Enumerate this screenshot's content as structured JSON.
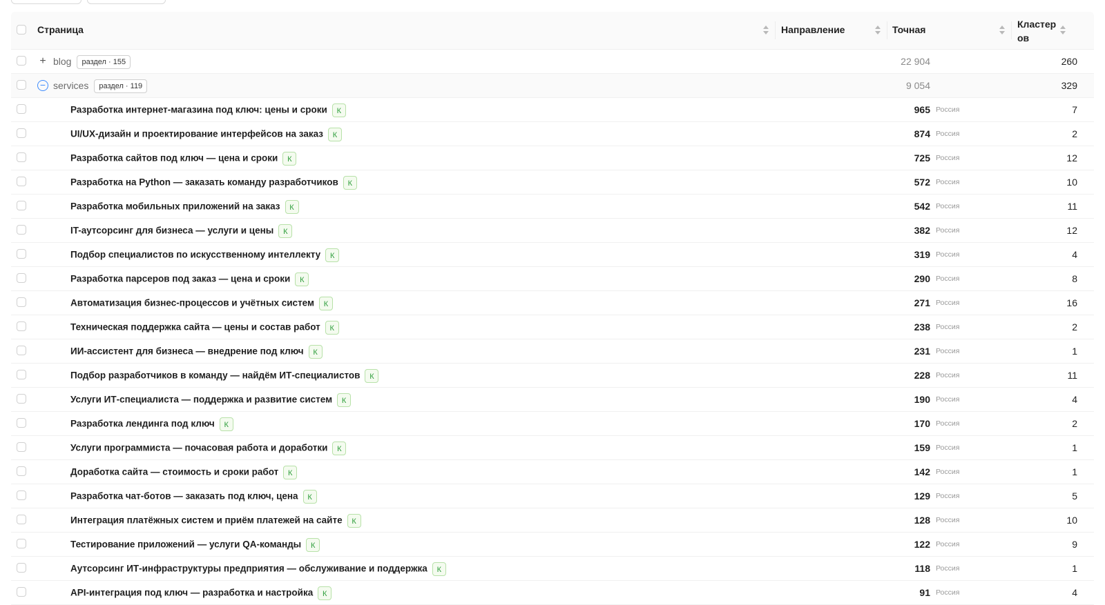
{
  "header": {
    "page": "Страница",
    "direction": "Направление",
    "exact": "Точная",
    "clusters_line1": "Кластер",
    "clusters_line2": "ов"
  },
  "groups": [
    {
      "name": "blog",
      "tag": "раздел · 155",
      "exact": "22 904",
      "clusters": "260",
      "expanded": false,
      "expander": "+"
    },
    {
      "name": "services",
      "tag": "раздел · 119",
      "exact": "9 054",
      "clusters": "329",
      "expanded": true,
      "expander": "−"
    }
  ],
  "badge_label": "К",
  "rows": [
    {
      "title": "Разработка интернет-магазина под ключ: цены и сроки",
      "exact": "965",
      "region": "Россия",
      "clusters": "7"
    },
    {
      "title": "UI/UX-дизайн и проектирование интерфейсов на заказ",
      "exact": "874",
      "region": "Россия",
      "clusters": "2"
    },
    {
      "title": "Разработка сайтов под ключ — цена и сроки",
      "exact": "725",
      "region": "Россия",
      "clusters": "12"
    },
    {
      "title": "Разработка на Python — заказать команду разработчиков",
      "exact": "572",
      "region": "Россия",
      "clusters": "10"
    },
    {
      "title": "Разработка мобильных приложений на заказ",
      "exact": "542",
      "region": "Россия",
      "clusters": "11"
    },
    {
      "title": "IT-аутсорсинг для бизнеса — услуги и цены",
      "exact": "382",
      "region": "Россия",
      "clusters": "12"
    },
    {
      "title": "Подбор специалистов по искусственному интеллекту",
      "exact": "319",
      "region": "Россия",
      "clusters": "4"
    },
    {
      "title": "Разработка парсеров под заказ — цена и сроки",
      "exact": "290",
      "region": "Россия",
      "clusters": "8"
    },
    {
      "title": "Автоматизация бизнес-процессов и учётных систем",
      "exact": "271",
      "region": "Россия",
      "clusters": "16"
    },
    {
      "title": "Техническая поддержка сайта — цены и состав работ",
      "exact": "238",
      "region": "Россия",
      "clusters": "2"
    },
    {
      "title": "ИИ-ассистент для бизнеса — внедрение под ключ",
      "exact": "231",
      "region": "Россия",
      "clusters": "1"
    },
    {
      "title": "Подбор разработчиков в команду — найдём ИТ-специалистов",
      "exact": "228",
      "region": "Россия",
      "clusters": "11"
    },
    {
      "title": "Услуги ИТ-специалиста — поддержка и развитие систем",
      "exact": "190",
      "region": "Россия",
      "clusters": "4"
    },
    {
      "title": "Разработка лендинга под ключ",
      "exact": "170",
      "region": "Россия",
      "clusters": "2"
    },
    {
      "title": "Услуги программиста — почасовая работа и доработки",
      "exact": "159",
      "region": "Россия",
      "clusters": "1"
    },
    {
      "title": "Доработка сайта — стоимость и сроки работ",
      "exact": "142",
      "region": "Россия",
      "clusters": "1"
    },
    {
      "title": "Разработка чат-ботов — заказать под ключ, цена",
      "exact": "129",
      "region": "Россия",
      "clusters": "5"
    },
    {
      "title": "Интеграция платёжных систем и приём платежей на сайте",
      "exact": "128",
      "region": "Россия",
      "clusters": "10"
    },
    {
      "title": "Тестирование приложений — услуги QA-команды",
      "exact": "122",
      "region": "Россия",
      "clusters": "9"
    },
    {
      "title": "Аутсорсинг ИТ-инфраструктуры предприятия — обслуживание и поддержка",
      "exact": "118",
      "region": "Россия",
      "clusters": "1"
    },
    {
      "title": "API-интеграция под ключ — разработка и настройка",
      "exact": "91",
      "region": "Россия",
      "clusters": "4"
    }
  ]
}
